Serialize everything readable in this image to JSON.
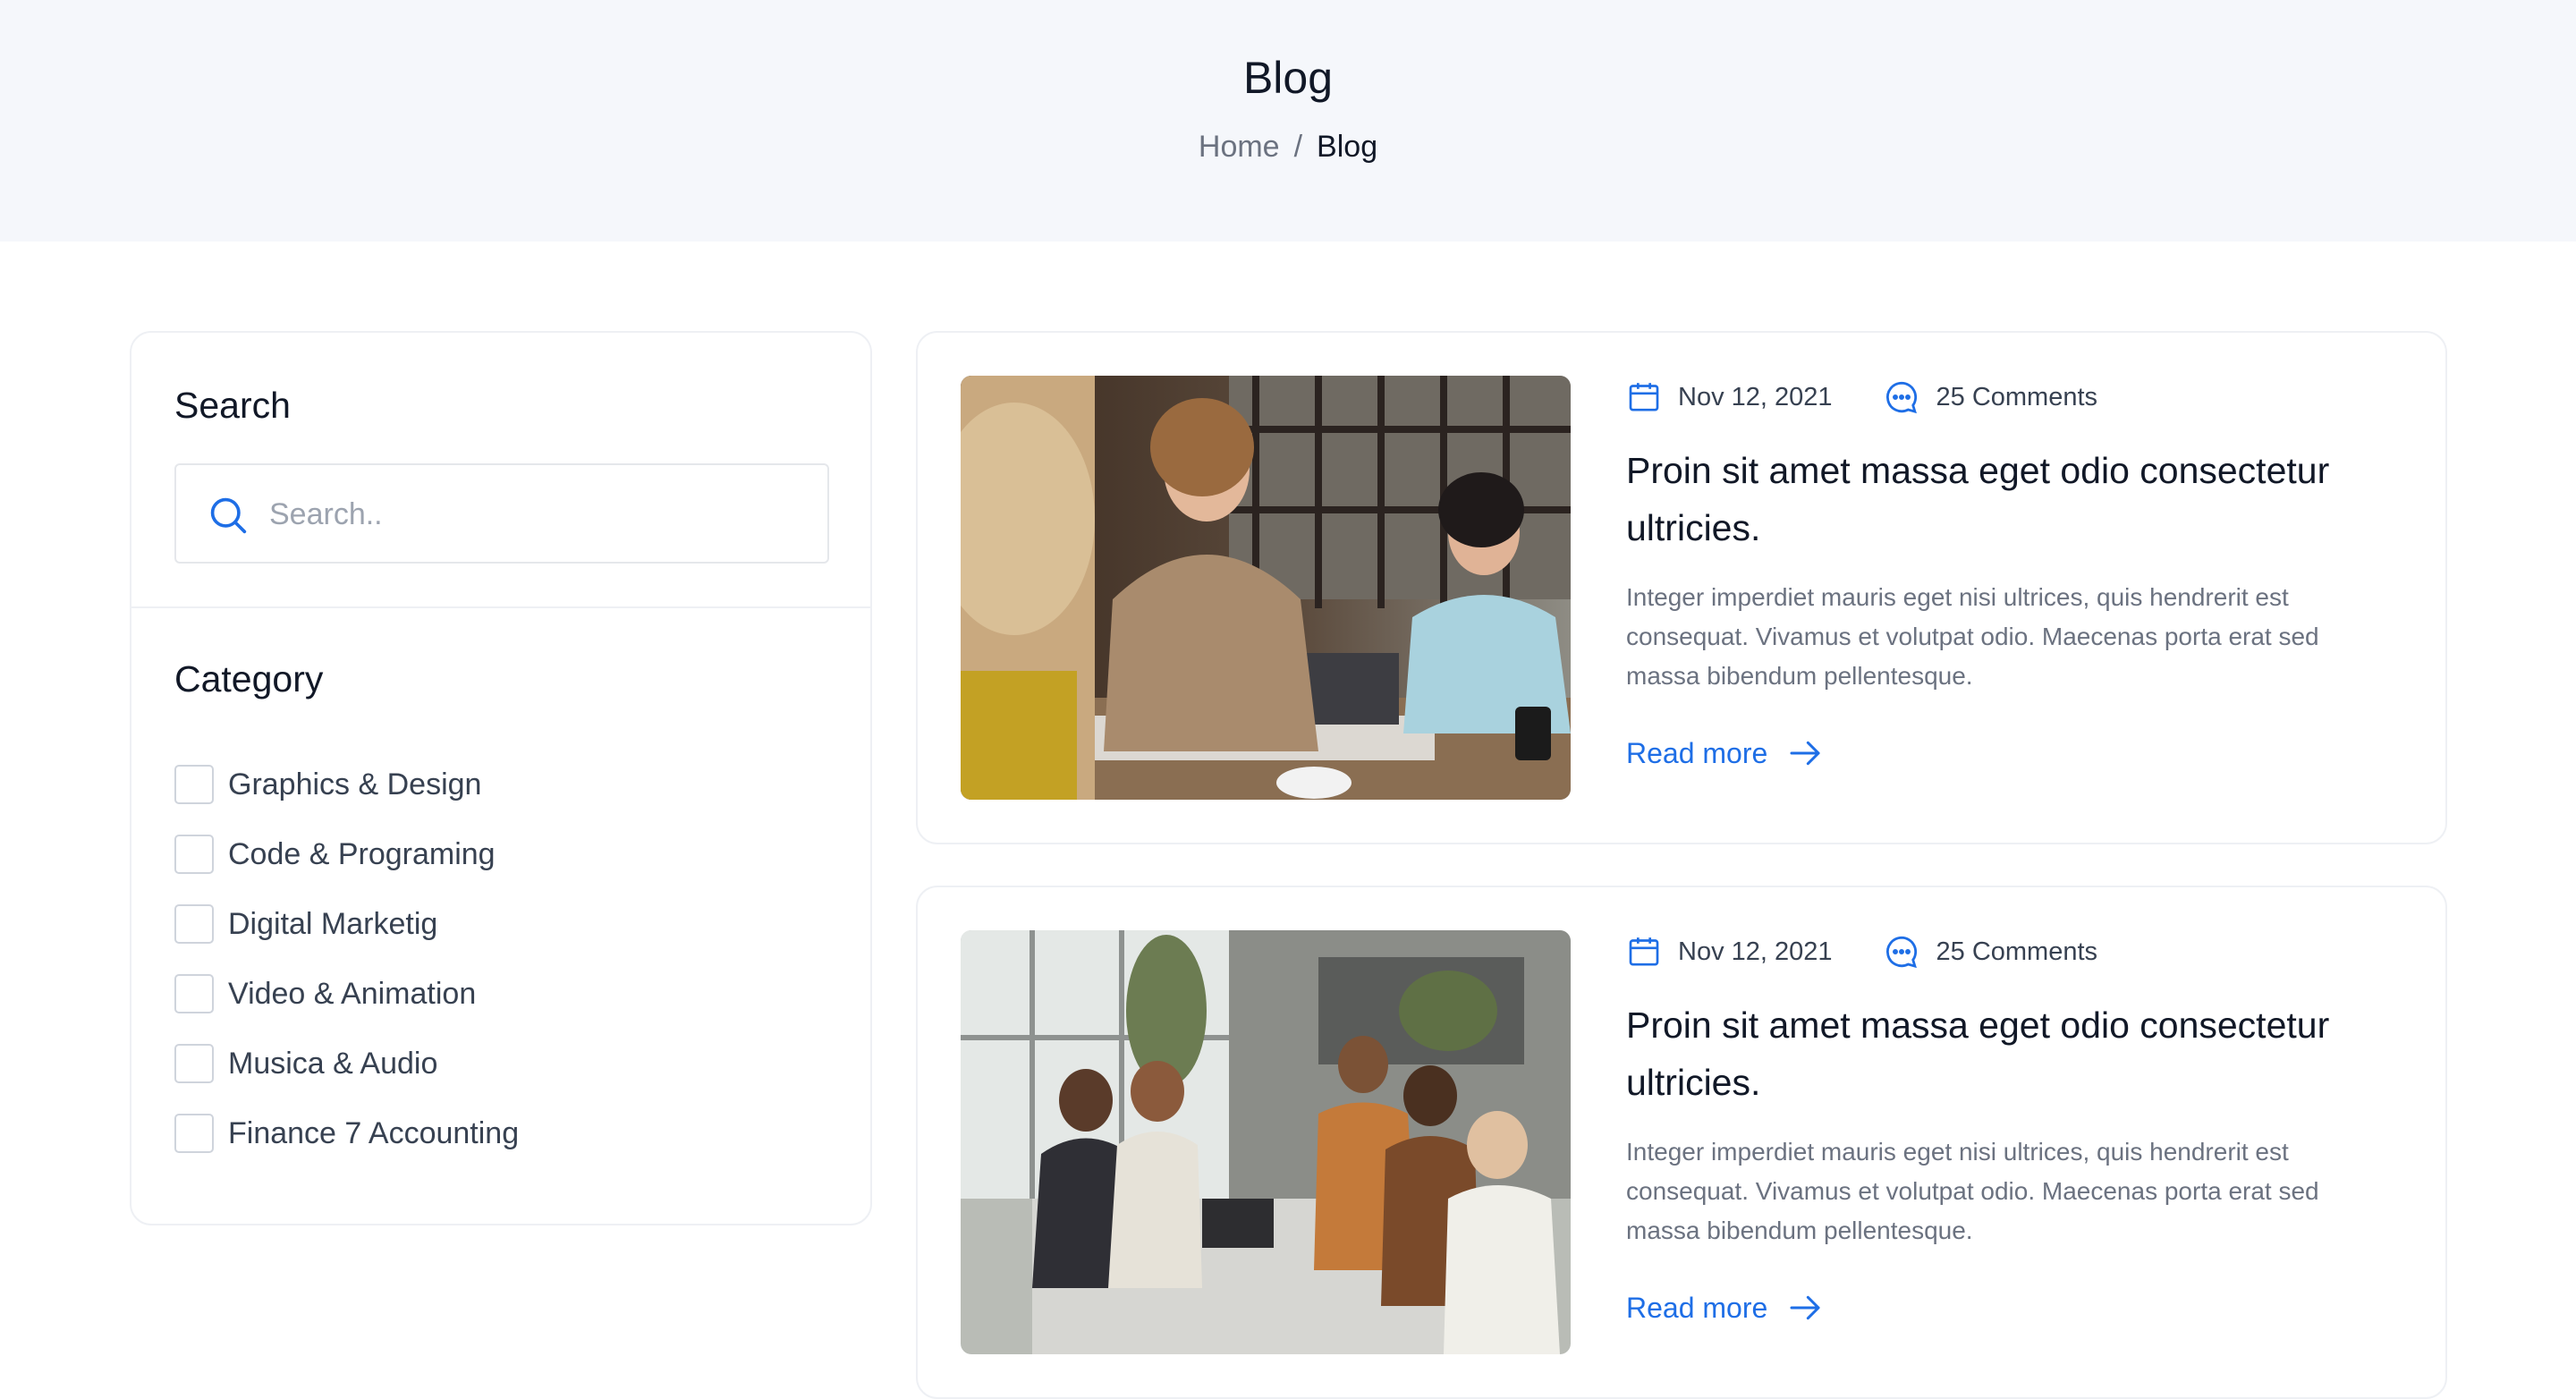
{
  "hero": {
    "title": "Blog",
    "breadcrumb": {
      "home": "Home",
      "separator": "/",
      "current": "Blog"
    }
  },
  "sidebar": {
    "search": {
      "title": "Search",
      "placeholder": "Search..",
      "icon": "search-icon"
    },
    "category": {
      "title": "Category",
      "items": [
        "Graphics & Design",
        "Code & Programing",
        "Digital Marketig",
        "Video & Animation",
        "Musica & Audio",
        "Finance 7 Accounting"
      ]
    }
  },
  "posts": [
    {
      "date": "Nov 12, 2021",
      "comments": "25 Comments",
      "title": "Proin sit amet massa eget odio consectetur ultricies.",
      "excerpt": "Integer imperdiet mauris eget nisi ultrices, quis hendrerit est consequat. Vivamus et volutpat odio. Maecenas porta erat sed massa bibendum pellentesque.",
      "read_more": "Read more"
    },
    {
      "date": "Nov 12, 2021",
      "comments": "25 Comments",
      "title": "Proin sit amet massa eget odio consectetur ultricies.",
      "excerpt": "Integer imperdiet mauris eget nisi ultrices, quis hendrerit est consequat. Vivamus et volutpat odio. Maecenas porta erat sed massa bibendum pellentesque.",
      "read_more": "Read more"
    }
  ],
  "colors": {
    "accent": "#1e6ee6",
    "hero_bg": "#f5f7fb",
    "heading": "#111827",
    "muted": "#6b7280"
  }
}
